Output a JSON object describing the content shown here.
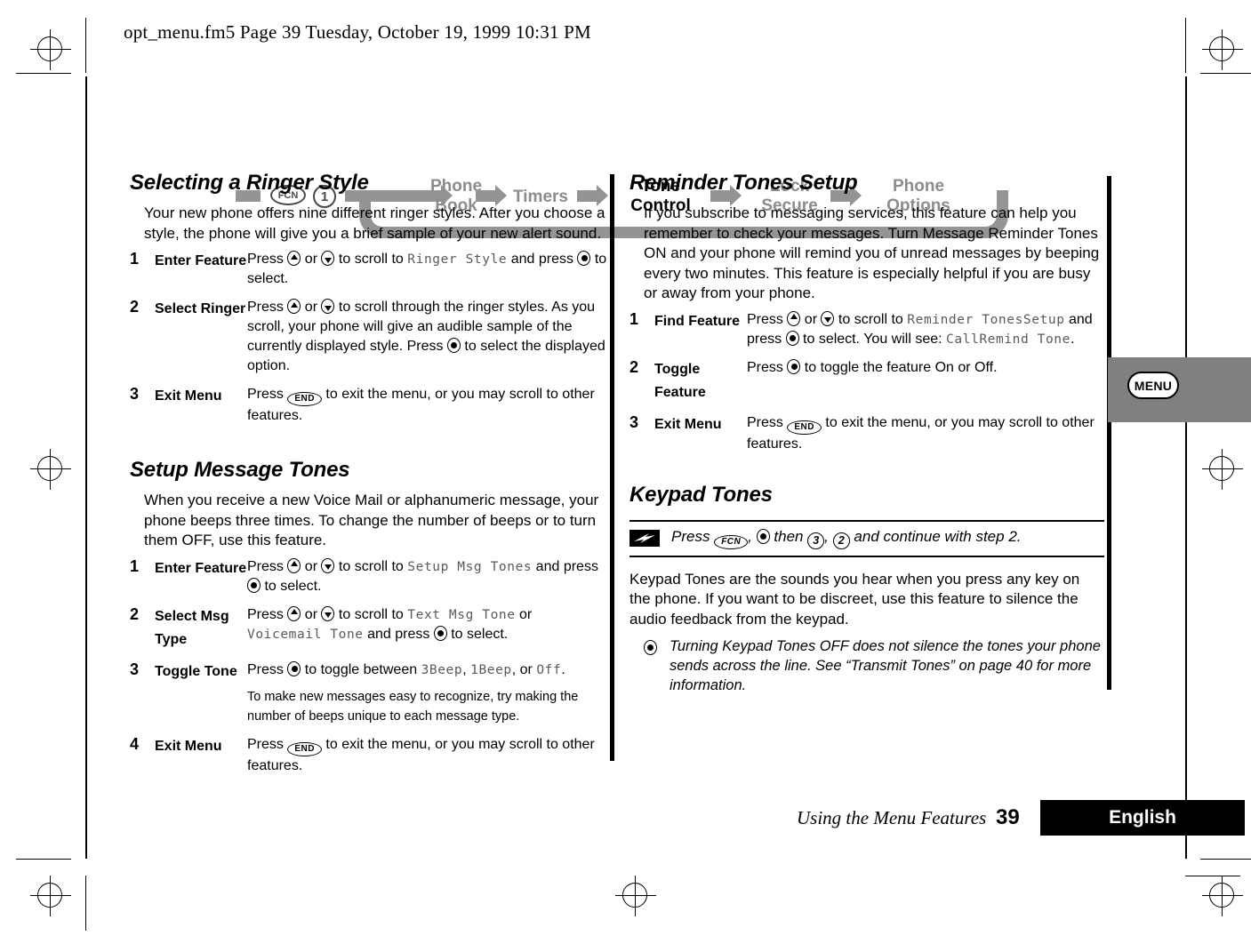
{
  "page_header": "opt_menu.fm5  Page 39  Tuesday, October 19, 1999  10:31 PM",
  "nav_map": {
    "keys": [
      {
        "label": "FCN",
        "shape": "oval"
      },
      {
        "label": "1",
        "shape": "round"
      }
    ],
    "items": [
      {
        "line1": "Phone",
        "line2": "Book",
        "active": false
      },
      {
        "line1": "Timers",
        "line2": "",
        "active": false
      },
      {
        "line1": "Tone",
        "line2": "Control",
        "active": true
      },
      {
        "line1": "Lock",
        "line2": "Secure",
        "active": false
      },
      {
        "line1": "Phone",
        "line2": "Options",
        "active": false
      }
    ],
    "accent_color": "#949494",
    "active_color": "#000000"
  },
  "left_column": {
    "sections": [
      {
        "heading": "Selecting a Ringer Style",
        "intro": "Your new phone offers nine different ringer styles. After you choose a style, the phone will give you a brief sample of your new alert sound.",
        "steps": [
          {
            "num": "1",
            "action": "Enter Feature",
            "parts": [
              [
                {
                  "t": "txt",
                  "v": "Press "
                },
                {
                  "t": "key",
                  "v": "nav-up"
                },
                {
                  "t": "txt",
                  "v": " or "
                },
                {
                  "t": "key",
                  "v": "nav-down"
                },
                {
                  "t": "txt",
                  "v": " to scroll to "
                },
                {
                  "t": "lcd",
                  "v": "Ringer Style"
                },
                {
                  "t": "txt",
                  "v": " and press "
                },
                {
                  "t": "key",
                  "v": "nav-select"
                },
                {
                  "t": "txt",
                  "v": " to select."
                }
              ]
            ]
          },
          {
            "num": "2",
            "action": "Select Ringer",
            "parts": [
              [
                {
                  "t": "txt",
                  "v": "Press "
                },
                {
                  "t": "key",
                  "v": "nav-up"
                },
                {
                  "t": "txt",
                  "v": " or "
                },
                {
                  "t": "key",
                  "v": "nav-down"
                },
                {
                  "t": "txt",
                  "v": " to scroll through the ringer styles. As you scroll, your phone will give an audible sample of the currently displayed style. Press "
                },
                {
                  "t": "key",
                  "v": "nav-select"
                },
                {
                  "t": "txt",
                  "v": " to select the displayed option."
                }
              ]
            ]
          },
          {
            "num": "3",
            "action": "Exit Menu",
            "parts": [
              [
                {
                  "t": "txt",
                  "v": "Press "
                },
                {
                  "t": "key",
                  "v": "END"
                },
                {
                  "t": "txt",
                  "v": " to exit the menu, or you may scroll to other features."
                }
              ]
            ]
          }
        ]
      },
      {
        "heading": "Setup Message Tones",
        "intro": "When you receive a new Voice Mail or alphanumeric message, your phone beeps three times. To change the number of beeps or to turn them OFF, use this feature.",
        "steps": [
          {
            "num": "1",
            "action": "Enter Feature",
            "parts": [
              [
                {
                  "t": "txt",
                  "v": "Press "
                },
                {
                  "t": "key",
                  "v": "nav-up"
                },
                {
                  "t": "txt",
                  "v": " or "
                },
                {
                  "t": "key",
                  "v": "nav-down"
                },
                {
                  "t": "txt",
                  "v": " to scroll to "
                },
                {
                  "t": "lcd",
                  "v": "Setup Msg Tones"
                },
                {
                  "t": "txt",
                  "v": " and press "
                },
                {
                  "t": "key",
                  "v": "nav-select"
                },
                {
                  "t": "txt",
                  "v": " to select."
                }
              ]
            ]
          },
          {
            "num": "2",
            "action": "Select Msg Type",
            "parts": [
              [
                {
                  "t": "txt",
                  "v": "Press "
                },
                {
                  "t": "key",
                  "v": "nav-up"
                },
                {
                  "t": "txt",
                  "v": " or "
                },
                {
                  "t": "key",
                  "v": "nav-down"
                },
                {
                  "t": "txt",
                  "v": " to scroll to "
                },
                {
                  "t": "lcd",
                  "v": "Text Msg Tone"
                },
                {
                  "t": "txt",
                  "v": " or "
                },
                {
                  "t": "lcd",
                  "v": "Voicemail Tone"
                },
                {
                  "t": "txt",
                  "v": " and press "
                },
                {
                  "t": "key",
                  "v": "nav-select"
                },
                {
                  "t": "txt",
                  "v": " to select."
                }
              ]
            ]
          },
          {
            "num": "3",
            "action": "Toggle Tone",
            "parts": [
              [
                {
                  "t": "txt",
                  "v": "Press "
                },
                {
                  "t": "key",
                  "v": "nav-select"
                },
                {
                  "t": "txt",
                  "v": " to toggle between "
                },
                {
                  "t": "lcd",
                  "v": "3Beep"
                },
                {
                  "t": "txt",
                  "v": ", "
                },
                {
                  "t": "lcd",
                  "v": "1Beep"
                },
                {
                  "t": "txt",
                  "v": ", or "
                },
                {
                  "t": "lcd",
                  "v": "Off"
                },
                {
                  "t": "txt",
                  "v": "."
                }
              ],
              [
                {
                  "t": "small",
                  "v": "To make new messages easy to recognize, try making the number of beeps unique to each message type."
                }
              ]
            ]
          },
          {
            "num": "4",
            "action": "Exit Menu",
            "parts": [
              [
                {
                  "t": "txt",
                  "v": "Press "
                },
                {
                  "t": "key",
                  "v": "END"
                },
                {
                  "t": "txt",
                  "v": " to exit the menu, or you may scroll to other features."
                }
              ]
            ]
          }
        ]
      }
    ]
  },
  "right_column": {
    "sections": [
      {
        "heading": "Reminder Tones Setup",
        "intro": "If you subscribe to messaging services, this feature can help you remember to check your messages. Turn Message Reminder Tones ON and your phone will remind you of unread messages by beeping every two minutes. This feature is especially helpful if you are busy or away from your phone.",
        "steps": [
          {
            "num": "1",
            "action": "Find Feature",
            "parts": [
              [
                {
                  "t": "txt",
                  "v": "Press "
                },
                {
                  "t": "key",
                  "v": "nav-up"
                },
                {
                  "t": "txt",
                  "v": " or "
                },
                {
                  "t": "key",
                  "v": "nav-down"
                },
                {
                  "t": "txt",
                  "v": " to scroll to "
                },
                {
                  "t": "lcd",
                  "v": "Reminder TonesSetup"
                },
                {
                  "t": "txt",
                  "v": " and press "
                },
                {
                  "t": "key",
                  "v": "nav-select"
                },
                {
                  "t": "txt",
                  "v": " to select. You will see: "
                },
                {
                  "t": "lcd",
                  "v": "CallRemind Tone"
                },
                {
                  "t": "txt",
                  "v": "."
                }
              ]
            ]
          },
          {
            "num": "2",
            "action": "Toggle Feature",
            "parts": [
              [
                {
                  "t": "txt",
                  "v": "Press "
                },
                {
                  "t": "key",
                  "v": "nav-select"
                },
                {
                  "t": "txt",
                  "v": " to toggle the feature On or Off."
                }
              ]
            ]
          },
          {
            "num": "3",
            "action": "Exit Menu",
            "parts": [
              [
                {
                  "t": "txt",
                  "v": "Press "
                },
                {
                  "t": "key",
                  "v": "END"
                },
                {
                  "t": "txt",
                  "v": " to exit the menu, or you may scroll to other features."
                }
              ]
            ]
          }
        ]
      }
    ],
    "keypad_tones": {
      "heading": "Keypad Tones",
      "shortcut": [
        {
          "t": "txt",
          "v": "Press "
        },
        {
          "t": "key",
          "v": "FCN"
        },
        {
          "t": "txt",
          "v": ", "
        },
        {
          "t": "key",
          "v": "nav-select"
        },
        {
          "t": "txt",
          "v": " then "
        },
        {
          "t": "key",
          "v": "3"
        },
        {
          "t": "txt",
          "v": ", "
        },
        {
          "t": "key",
          "v": "2"
        },
        {
          "t": "txt",
          "v": " and continue with step 2."
        }
      ],
      "intro": "Keypad Tones are the sounds you hear when you press any key on the phone. If you want to be discreet, use this feature to silence the audio feedback from the keypad.",
      "note": "Turning Keypad Tones OFF does not silence the tones your phone sends across the line. See “Transmit Tones” on page 40 for more information."
    }
  },
  "menu_tab": {
    "label": "MENU"
  },
  "footer": {
    "title": "Using the Menu Features",
    "page_number": "39",
    "language": "English"
  }
}
